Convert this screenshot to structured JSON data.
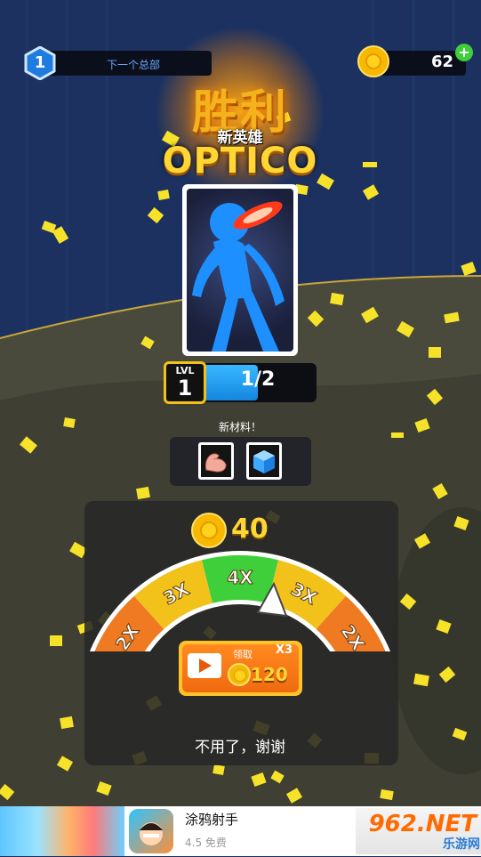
{
  "hud": {
    "level": "1",
    "next_boss_label": "下一个总部",
    "coins": "62",
    "add_coins_symbol": "+"
  },
  "victory": {
    "title": "胜利",
    "new_hero_label": "新英雄",
    "hero_name": "OPTICO"
  },
  "hero_level": {
    "lvl_label": "LVL",
    "lvl_value": "1",
    "progress_text": "1/2",
    "progress_fraction": 0.5
  },
  "materials": {
    "label": "新材料！",
    "items": [
      {
        "icon": "arm-muscle-icon"
      },
      {
        "icon": "ice-cube-icon"
      }
    ]
  },
  "reward": {
    "coins": "40",
    "multipliers": [
      "2X",
      "3X",
      "4X",
      "3X",
      "2X"
    ],
    "multiplier_colors": [
      "#f07a22",
      "#f2c21a",
      "#3fcf3b",
      "#f2c21a",
      "#f07a22"
    ]
  },
  "ad_button": {
    "claim_label": "领取",
    "multiplier": "X3",
    "value": "120"
  },
  "no_thanks": "不用了，谢谢",
  "banner": {
    "app_name": "涂鸦射手",
    "app_meta": "4.5 免费"
  },
  "watermark": {
    "text": "962.NET",
    "sub": "乐游网"
  }
}
